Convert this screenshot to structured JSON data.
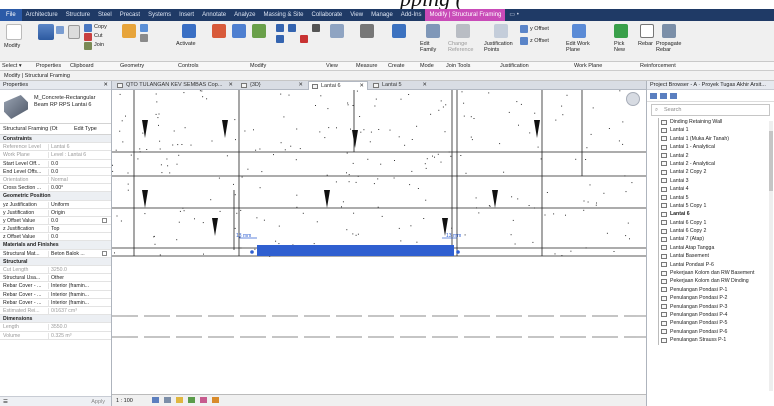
{
  "heading": "pping (",
  "ribbon_tabs": [
    "File",
    "Architecture",
    "Structure",
    "Steel",
    "Precast",
    "Systems",
    "Insert",
    "Annotate",
    "Analyze",
    "Massing & Site",
    "Collaborate",
    "View",
    "Manage",
    "Add-Ins",
    "Modify | Structural Framing",
    "▭ •"
  ],
  "ribbon": {
    "groups": [
      "Select ▾",
      "Properties",
      "Clipboard",
      "Geometry",
      "Controls",
      "Modify",
      "View",
      "Measure",
      "Create",
      "Mode",
      "Join Tools",
      "Justification",
      "Work Plane",
      "Reinforcement"
    ],
    "buttons": {
      "modify": "Modify",
      "copy": "Copy",
      "cut": "Cut",
      "join": "Join",
      "paste": "Paste",
      "activate": "Activate",
      "edit_family": "Edit Family",
      "change_reference": "Change Reference",
      "justification_points": "Justification Points",
      "y_offset": "y Offset",
      "z_offset": "z Offset",
      "edit_work_plane": "Edit Work Plane",
      "pick_new": "Pick New",
      "rebar": "Rebar",
      "propagate_rebar": "Propagate Rebar"
    }
  },
  "context_label": "Modify | Structural Framing",
  "properties": {
    "title": "Properties",
    "type_name": "M_Concrete-Rectangular Beam RP RPS Lantai 6",
    "filter": "Structural Framing (Ot",
    "edit_type": "Edit Type",
    "rows": [
      {
        "k": "Constraints",
        "v": "",
        "sec": true
      },
      {
        "k": "Reference Level",
        "v": "Lantai 6",
        "grey": true
      },
      {
        "k": "Work Plane",
        "v": "Level : Lantai 6",
        "grey": true
      },
      {
        "k": "Start Level Off...",
        "v": "0.0"
      },
      {
        "k": "End Level Offs...",
        "v": "0.0"
      },
      {
        "k": "Orientation",
        "v": "Normal",
        "grey": true
      },
      {
        "k": "Cross Section ...",
        "v": "0.00°"
      },
      {
        "k": "Geometric Position",
        "v": "",
        "sec": true
      },
      {
        "k": "yz Justification",
        "v": "Uniform"
      },
      {
        "k": "y Justification",
        "v": "Origin"
      },
      {
        "k": "y Offset Value",
        "v": "0.0",
        "chk": true
      },
      {
        "k": "z Justification",
        "v": "Top"
      },
      {
        "k": "z Offset Value",
        "v": "0.0"
      },
      {
        "k": "Materials and Finishes",
        "v": "",
        "sec": true
      },
      {
        "k": "Structural Mat...",
        "v": "Beton Balok ...",
        "chk": true
      },
      {
        "k": "Structural",
        "v": "",
        "sec": true
      },
      {
        "k": "Cut Length",
        "v": "3250.0",
        "grey": true
      },
      {
        "k": "Structural Usa...",
        "v": "Other"
      },
      {
        "k": "Rebar Cover - ...",
        "v": "Interior (framin..."
      },
      {
        "k": "Rebar Cover - ...",
        "v": "Interior (framin..."
      },
      {
        "k": "Rebar Cover - ...",
        "v": "Interior (framin..."
      },
      {
        "k": "Estimated Rei...",
        "v": "0/1637 cm³",
        "grey": true
      },
      {
        "k": "Dimensions",
        "v": "",
        "sec": true
      },
      {
        "k": "Length",
        "v": "3550.0",
        "grey": true
      },
      {
        "k": "Volume",
        "v": "0.325 m³",
        "grey": true
      }
    ],
    "apply": "Apply"
  },
  "view_tabs": [
    {
      "label": "QTO TULANGAN KEV SEMBAS Cop...",
      "active": false
    },
    {
      "label": "{3D}",
      "active": false
    },
    {
      "label": "Lantai 6",
      "active": true
    },
    {
      "label": "Lantai 5",
      "active": false
    }
  ],
  "canvas": {
    "dim_left": "13 mm",
    "dim_right": "13 mm"
  },
  "view_control": {
    "scale": "1 : 100"
  },
  "project_browser": {
    "title": "Project Browser - A · Proyek Tugas Akhir Arsit...",
    "search_placeholder": "Search",
    "items": [
      {
        "label": "Dinding Retaining Wall"
      },
      {
        "label": "Lantai 1"
      },
      {
        "label": "Lantai 1 (Muka Air Tanah)"
      },
      {
        "label": "Lantai 1 - Analytical"
      },
      {
        "label": "Lantai 2"
      },
      {
        "label": "Lantai 2 - Analytical"
      },
      {
        "label": "Lantai 2 Copy 2"
      },
      {
        "label": "Lantai 3"
      },
      {
        "label": "Lantai 4"
      },
      {
        "label": "Lantai 5"
      },
      {
        "label": "Lantai 5 Copy 1"
      },
      {
        "label": "Lantai 6",
        "bold": true
      },
      {
        "label": "Lantai 6 Copy 1"
      },
      {
        "label": "Lantai 6 Copy 2"
      },
      {
        "label": "Lantai 7 (Atap)"
      },
      {
        "label": "Lantai Atap Tangga"
      },
      {
        "label": "Lantai Basement"
      },
      {
        "label": "Lantai Pondasi P-6"
      },
      {
        "label": "Pekerjaan Kolom dan RW Basement"
      },
      {
        "label": "Pekerjaan Kolom dan RW Dinding"
      },
      {
        "label": "Penulangan Pondasi P-1"
      },
      {
        "label": "Penulangan Pondasi P-2"
      },
      {
        "label": "Penulangan Pondasi P-3"
      },
      {
        "label": "Penulangan Pondasi P-4"
      },
      {
        "label": "Penulangan Pondasi P-5"
      },
      {
        "label": "Penulangan Pondasi P-6"
      },
      {
        "label": "Penulangan Strauss P-1"
      }
    ]
  },
  "colors": {
    "tabbar": "#1f3a66",
    "active_tab": "#c94bb8",
    "selection": "#2f5fd0"
  }
}
